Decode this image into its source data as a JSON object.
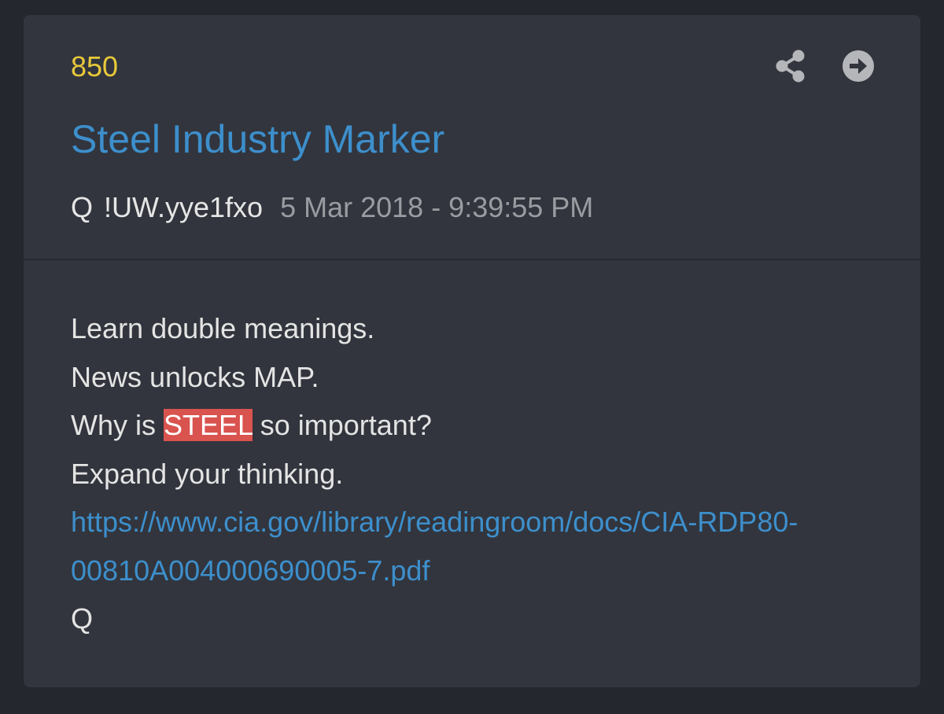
{
  "post": {
    "number": "850",
    "title": "Steel Industry Marker",
    "author": "Q",
    "tripcode": "!UW.yye1fxo",
    "timestamp": "5 Mar 2018 - 9:39:55 PM",
    "actions": {
      "share_icon": "share-icon",
      "open_icon": "arrow-circle-right-icon"
    },
    "body": {
      "line1": "Learn double meanings.",
      "line2": "News unlocks MAP.",
      "line3_before": "Why is ",
      "line3_highlight": "STEEL",
      "line3_after": " so important?",
      "line4": "Expand your thinking.",
      "link": "https://www.cia.gov/library/readingroom/docs/CIA-RDP80-00810A004000690005-7.pdf",
      "signature": "Q"
    }
  },
  "colors": {
    "background": "#24272e",
    "card": "#32353d",
    "number": "#e8c93a",
    "title": "#3d8fcc",
    "highlight": "#d9534f"
  }
}
